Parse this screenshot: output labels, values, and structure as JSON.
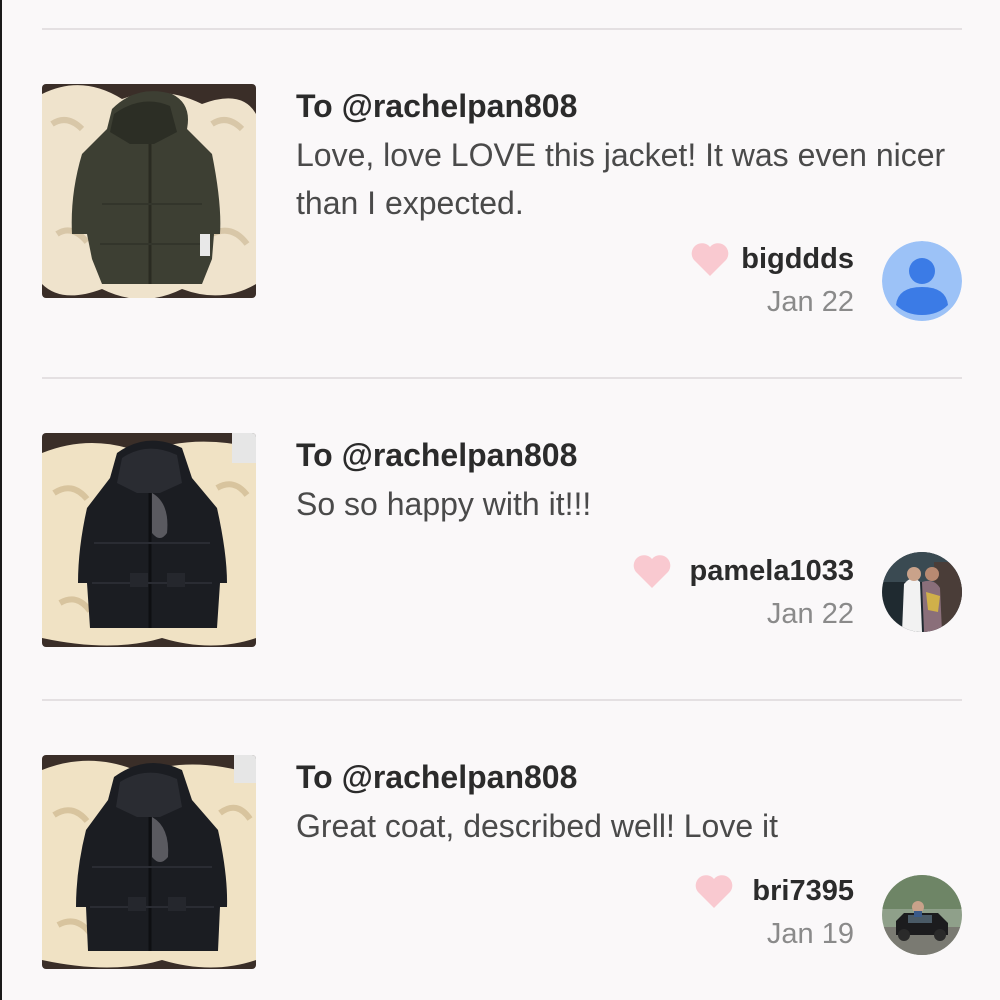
{
  "reviews": [
    {
      "to": "To @rachelpan808",
      "comment": "Love, love LOVE this jacket! It was even nicer than I expected.",
      "username": "bigddds",
      "date": "Jan 22"
    },
    {
      "to": "To @rachelpan808",
      "comment": "So so happy with it!!!",
      "username": "pamela1033",
      "date": "Jan 22"
    },
    {
      "to": "To @rachelpan808",
      "comment": "Great coat, described well! Love it",
      "username": "bri7395",
      "date": "Jan 19"
    }
  ],
  "colors": {
    "background": "#faf8f9",
    "heart": "#f9c9d0",
    "default_avatar_bg": "#9cc2f7",
    "default_avatar_fg": "#3b7be6",
    "divider": "#e4e0e2"
  },
  "icons": {
    "like": "heart-icon",
    "default_avatar": "person-icon"
  }
}
